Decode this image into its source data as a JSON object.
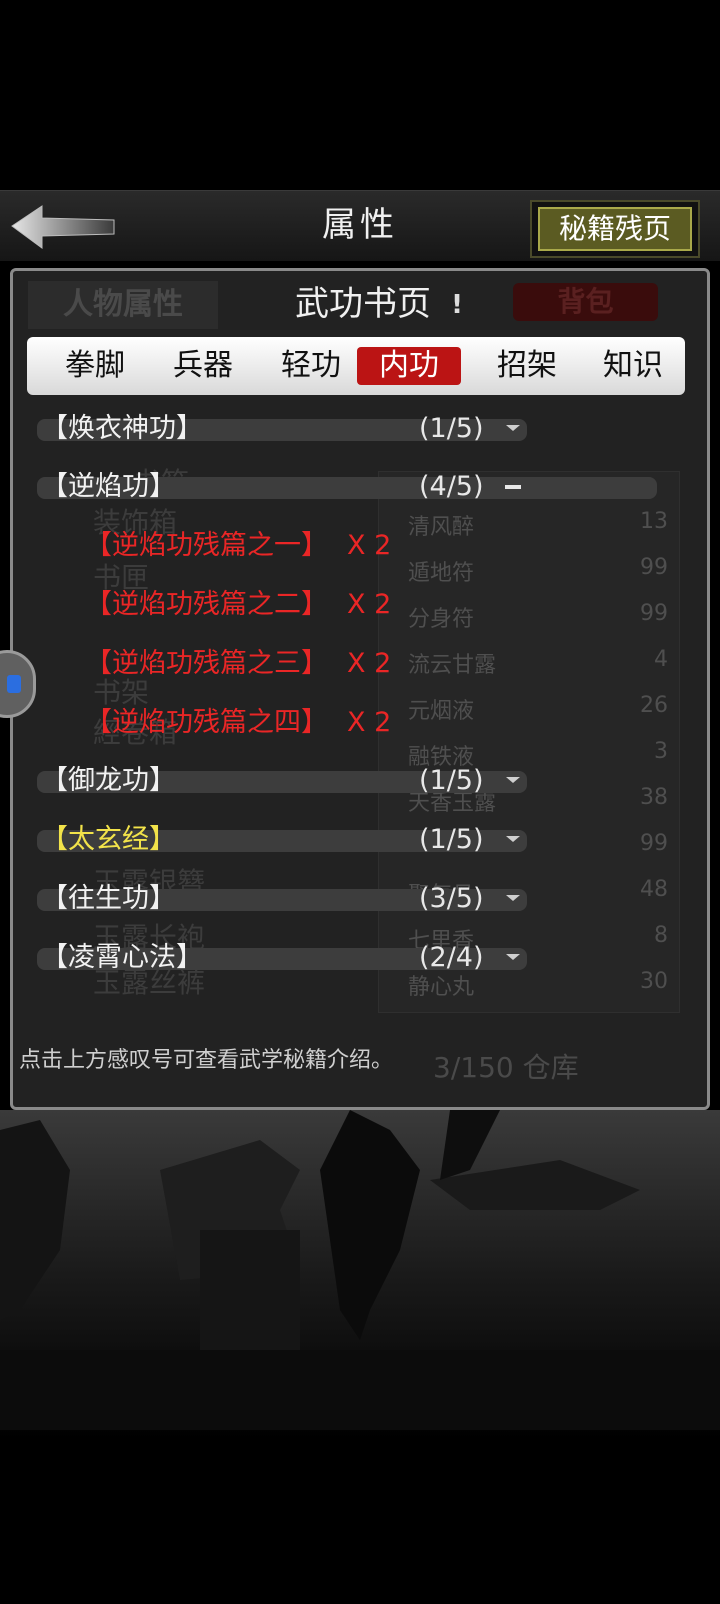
{
  "header": {
    "title": "属性",
    "secret_pages_button": "秘籍残页"
  },
  "panel": {
    "title": "武功书页",
    "info_mark": "!",
    "background": {
      "tab_character": "人物属性",
      "tab_bag": "背包",
      "inventory": [
        {
          "name": "清风醉",
          "qty": "13"
        },
        {
          "name": "遁地符",
          "qty": "99"
        },
        {
          "name": "分身符",
          "qty": "99"
        },
        {
          "name": "流云甘露",
          "qty": "4"
        },
        {
          "name": "元烟液",
          "qty": "26"
        },
        {
          "name": "融铁液",
          "qty": "3"
        },
        {
          "name": "天香玉露",
          "qty": "38"
        },
        {
          "name": "",
          "qty": "99"
        },
        {
          "name": "聚气丹",
          "qty": "48"
        },
        {
          "name": "七里香",
          "qty": "8"
        },
        {
          "name": "静心丸",
          "qty": "30"
        }
      ],
      "left_items": [
        "书箱",
        "装饰箱",
        "书匣",
        "书架",
        "經卷箱",
        "玉露银簪",
        "玉露长袍",
        "玉露丝裤"
      ],
      "capacity": "3/150 仓库"
    },
    "tabs": [
      {
        "label": "拳脚",
        "active": false
      },
      {
        "label": "兵器",
        "active": false
      },
      {
        "label": "轻功",
        "active": false
      },
      {
        "label": "内功",
        "active": true
      },
      {
        "label": "招架",
        "active": false
      },
      {
        "label": "知识",
        "active": false
      }
    ],
    "skills": [
      {
        "name": "【焕衣神功】",
        "progress": "(1/5)",
        "expanded": false
      },
      {
        "name": "【逆焰功】",
        "progress": "(4/5)",
        "expanded": true
      },
      {
        "name": "【御龙功】",
        "progress": "(1/5)",
        "expanded": false
      },
      {
        "name": "【太玄经】",
        "progress": "(1/5)",
        "expanded": false,
        "color": "#f2e34a"
      },
      {
        "name": "【往生功】",
        "progress": "(3/5)",
        "expanded": false
      },
      {
        "name": "【凌霄心法】",
        "progress": "(2/4)",
        "expanded": false
      }
    ],
    "fragments": [
      {
        "name": "【逆焰功残篇之一】",
        "count": "X 2"
      },
      {
        "name": "【逆焰功残篇之二】",
        "count": "X 2"
      },
      {
        "name": "【逆焰功残篇之三】",
        "count": "X 2"
      },
      {
        "name": "【逆焰功残篇之四】",
        "count": "X 2"
      }
    ],
    "hint": "点击上方感叹号可查看武学秘籍介绍。"
  },
  "colors": {
    "active_tab": "#bb1414",
    "fragment_text": "#ea2626",
    "highlight_skill": "#f2e34a",
    "secret_button": "#5b5b22"
  }
}
